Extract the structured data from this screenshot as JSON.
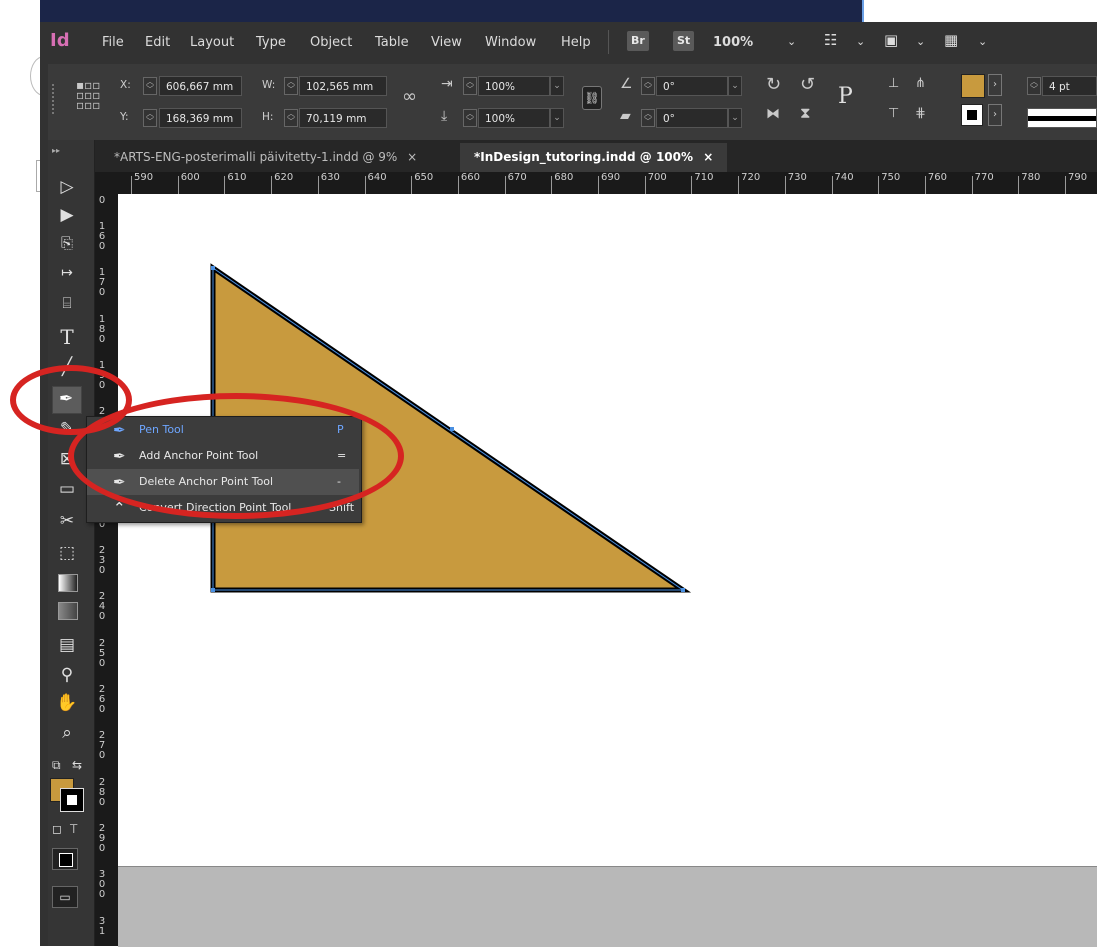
{
  "app": {
    "logo": "Id"
  },
  "menu": [
    "File",
    "Edit",
    "Layout",
    "Type",
    "Object",
    "Table",
    "View",
    "Window",
    "Help"
  ],
  "menu_pills": {
    "bridge": "Br",
    "stock": "St"
  },
  "zoom": "100%",
  "control_panel": {
    "x_label": "X:",
    "x_value": "606,667 mm",
    "y_label": "Y:",
    "y_value": "168,369 mm",
    "w_label": "W:",
    "w_value": "102,565 mm",
    "h_label": "H:",
    "h_value": "70,119 mm",
    "scale_x": "100%",
    "scale_y": "100%",
    "angle": "0°",
    "shear": "0°",
    "stroke_weight": "4 pt",
    "text_frame_icon": "P"
  },
  "tabs": [
    {
      "label": "*ARTS-ENG-posterimalli päivitetty-1.indd @ 9%",
      "close": "×"
    },
    {
      "label": "*InDesign_tutoring.indd @ 100%",
      "close": "×"
    }
  ],
  "ruler_top": [
    "590",
    "600",
    "610",
    "620",
    "630",
    "640",
    "650",
    "660",
    "670",
    "680",
    "690",
    "700",
    "710",
    "720",
    "730",
    "740",
    "750",
    "760",
    "770",
    "780",
    "790"
  ],
  "ruler_left": [
    "0",
    "160",
    "170",
    "180",
    "190",
    "200",
    "210",
    "220",
    "230",
    "240",
    "250",
    "260",
    "270",
    "280",
    "290",
    "300",
    "31"
  ],
  "flyout": [
    {
      "label": "Pen Tool",
      "shortcut": "P"
    },
    {
      "label": "Add Anchor Point Tool",
      "shortcut": "="
    },
    {
      "label": "Delete Anchor Point Tool",
      "shortcut": "-"
    },
    {
      "label": "Convert Direction Point Tool",
      "shortcut": "Shift"
    }
  ],
  "colors": {
    "shape_fill": "#c89a3e",
    "shape_stroke": "#000000",
    "selection": "#4a90e2",
    "annotation": "#d62421",
    "fill_swatch": "#c89a3e"
  },
  "tool_icons": [
    "selection-icon",
    "direct-selection-icon",
    "page-tool-icon",
    "gap-tool-icon",
    "content-collector-icon",
    "type-tool-icon",
    "line-tool-icon",
    "pen-tool-icon",
    "pencil-tool-icon",
    "rectangle-frame-icon",
    "rectangle-tool-icon",
    "scissors-icon",
    "free-transform-icon",
    "gradient-swatch-icon",
    "gradient-feather-icon",
    "note-tool-icon",
    "eyedropper-icon",
    "hand-tool-icon",
    "zoom-tool-icon"
  ]
}
